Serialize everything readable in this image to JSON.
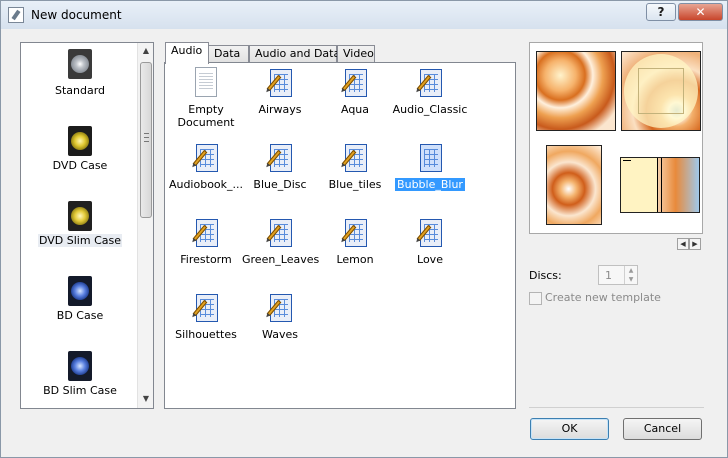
{
  "window": {
    "title": "New document",
    "help": "?",
    "close": "✕"
  },
  "sidebar": {
    "items": [
      {
        "label": "Standard"
      },
      {
        "label": "DVD Case"
      },
      {
        "label": "DVD Slim Case"
      },
      {
        "label": "BD Case"
      },
      {
        "label": "BD Slim Case"
      }
    ],
    "selected": "DVD Slim Case"
  },
  "tabs": [
    {
      "label": "Audio"
    },
    {
      "label": "Data"
    },
    {
      "label": "Audio and Data"
    },
    {
      "label": "Video"
    }
  ],
  "active_tab": "Audio",
  "templates": [
    {
      "label": "Empty Document",
      "icon": "blank-document-icon"
    },
    {
      "label": "Airways",
      "icon": "template-icon"
    },
    {
      "label": "Aqua",
      "icon": "template-icon"
    },
    {
      "label": "Audio_Classic",
      "icon": "template-icon"
    },
    {
      "label": "Audiobook_...",
      "icon": "template-icon"
    },
    {
      "label": "Blue_Disc",
      "icon": "template-icon"
    },
    {
      "label": "Blue_tiles",
      "icon": "template-icon"
    },
    {
      "label": "Bubble_Blur",
      "icon": "template-icon"
    },
    {
      "label": "Firestorm",
      "icon": "template-icon"
    },
    {
      "label": "Green_Leaves",
      "icon": "template-icon"
    },
    {
      "label": "Lemon",
      "icon": "template-icon"
    },
    {
      "label": "Love",
      "icon": "template-icon"
    },
    {
      "label": "Silhouettes",
      "icon": "template-icon"
    },
    {
      "label": "Waves",
      "icon": "template-icon"
    }
  ],
  "selected_template": "Bubble_Blur",
  "options": {
    "discs_label": "Discs:",
    "discs_value": "1",
    "create_template_label": "Create new template",
    "create_template_checked": false
  },
  "buttons": {
    "ok": "OK",
    "cancel": "Cancel"
  },
  "colors": {
    "selection": "#3399ff",
    "close_button": "#c8452b",
    "window_bg": "#f0f0f0"
  }
}
